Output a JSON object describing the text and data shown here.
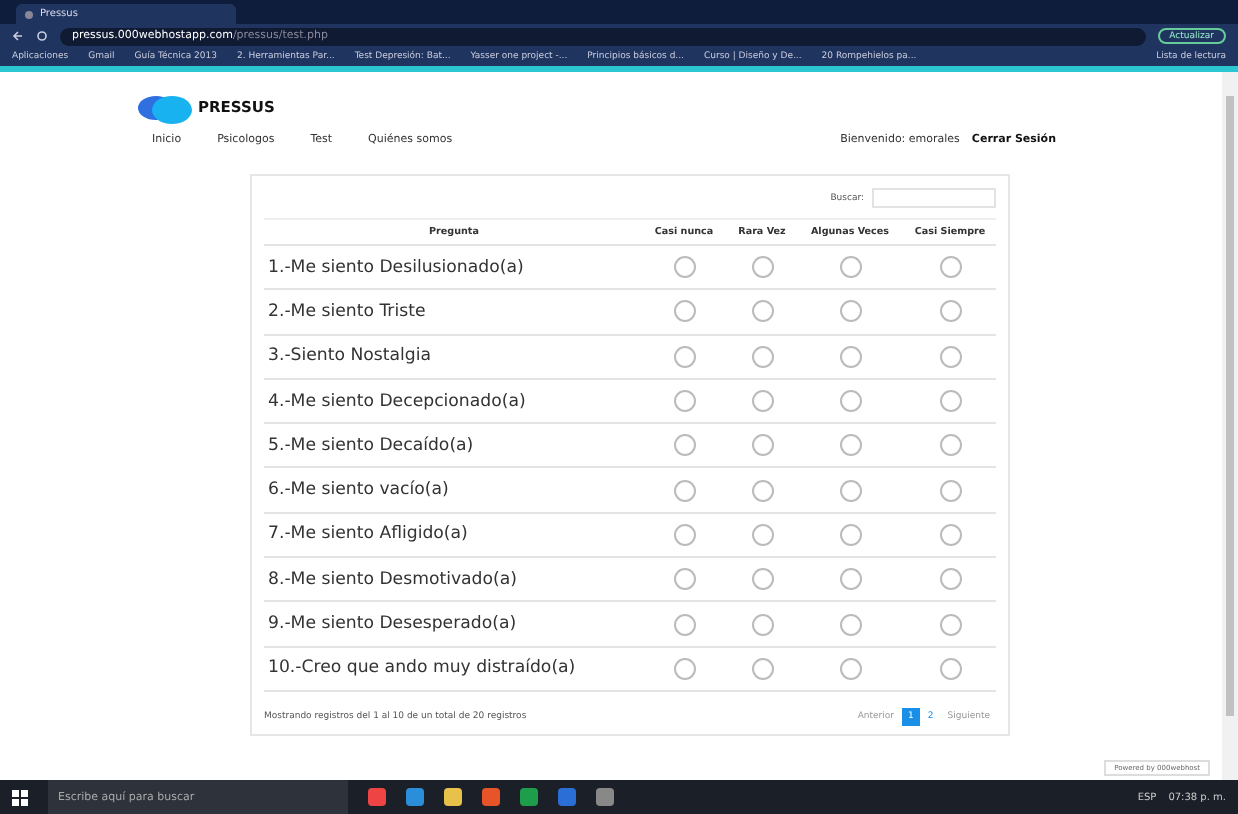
{
  "browser": {
    "tab_title": "Pressus",
    "url_host": "pressus.000webhostapp.com",
    "url_path": "/pressus/test.php",
    "update_button": "Actualizar",
    "bookmarks": [
      "Aplicaciones",
      "Gmail",
      "Guía Técnica 2013",
      "2. Herramientas Par...",
      "Test Depresión: Bat...",
      "Yasser one project -...",
      "Principios básicos d...",
      "Curso | Diseño y De...",
      "20 Rompehielos pa..."
    ],
    "reading_list": "Lista de lectura"
  },
  "site": {
    "logo": "PRESSUS",
    "nav": [
      "Inicio",
      "Psicologos",
      "Test",
      "Quiénes somos"
    ],
    "welcome": "Bienvenido: emorales",
    "logout": "Cerrar Sesión"
  },
  "table": {
    "search_label": "Buscar:",
    "columns": [
      "Pregunta",
      "Casi nunca",
      "Rara Vez",
      "Algunas Veces",
      "Casi Siempre"
    ],
    "rows": [
      {
        "question": "1.-Me siento Desilusionado(a)",
        "answers": [
          false,
          false,
          false,
          false
        ]
      },
      {
        "question": "2.-Me siento Triste",
        "answers": [
          false,
          false,
          false,
          false
        ]
      },
      {
        "question": "3.-Siento Nostalgia",
        "answers": [
          false,
          false,
          false,
          false
        ]
      },
      {
        "question": "4.-Me siento Decepcionado(a)",
        "answers": [
          false,
          false,
          false,
          false
        ]
      },
      {
        "question": "5.-Me siento Decaído(a)",
        "answers": [
          false,
          false,
          false,
          false
        ]
      },
      {
        "question": "6.-Me siento vacío(a)",
        "answers": [
          false,
          false,
          false,
          false
        ]
      },
      {
        "question": "7.-Me siento Afligido(a)",
        "answers": [
          false,
          false,
          false,
          false
        ]
      },
      {
        "question": "8.-Me siento Desmotivado(a)",
        "answers": [
          false,
          false,
          false,
          false
        ]
      },
      {
        "question": "9.-Me siento Desesperado(a)",
        "answers": [
          false,
          false,
          false,
          false
        ]
      },
      {
        "question": "10.-Creo que ando muy distraído(a)",
        "answers": [
          false,
          false,
          false,
          false
        ]
      }
    ],
    "info": "Mostrando registros del 1 al 10 de un total de 20 registros",
    "pagination": [
      {
        "label": "Anterior",
        "kind": "nav",
        "selected": false
      },
      {
        "label": "1",
        "kind": "page",
        "selected": true
      },
      {
        "label": "2",
        "kind": "page",
        "selected": false
      },
      {
        "label": "Siguiente",
        "kind": "nav",
        "selected": false
      }
    ]
  },
  "powered": "Powered by 000webhost",
  "taskbar": {
    "search_placeholder": "Escribe aquí para buscar",
    "language": "ESP",
    "time": "07:38 p. m."
  }
}
